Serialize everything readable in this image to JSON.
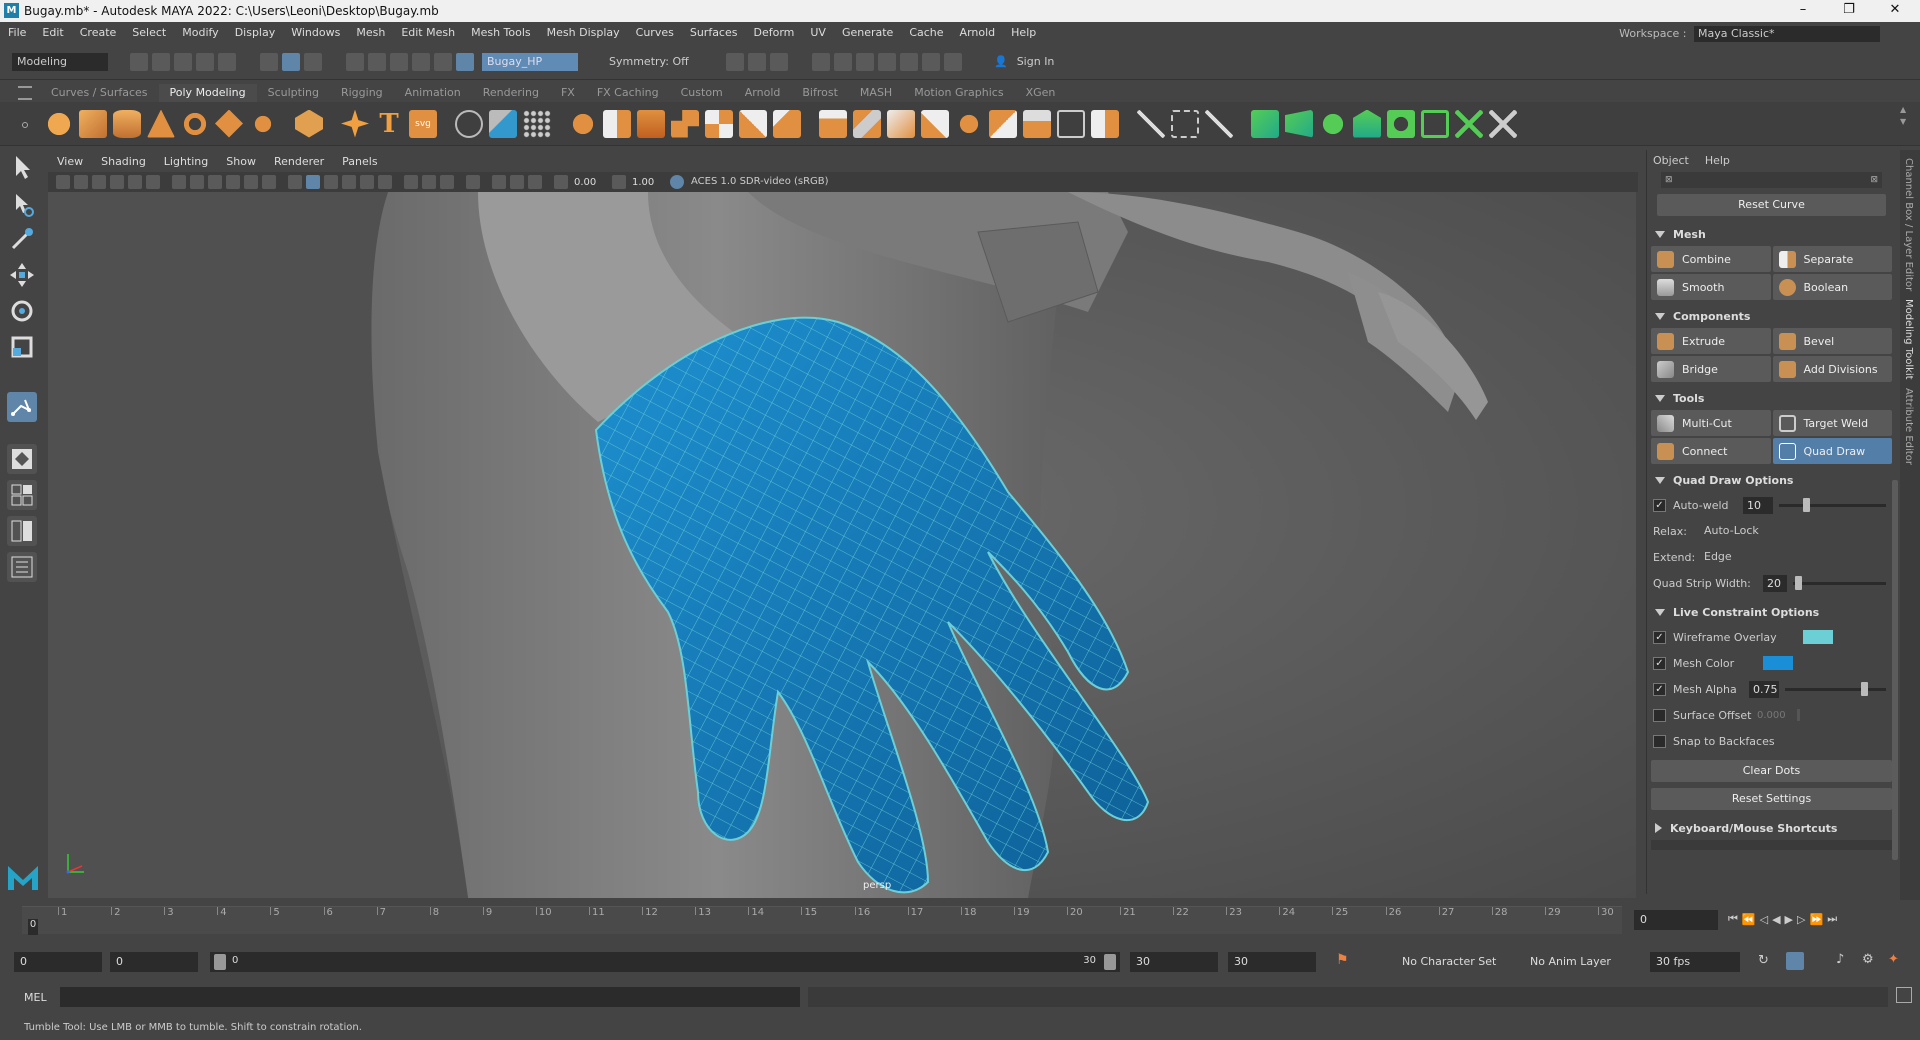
{
  "window": {
    "title": "Bugay.mb* - Autodesk MAYA 2022: C:\\Users\\Leoni\\Desktop\\Bugay.mb",
    "min": "–",
    "max": "❐",
    "close": "✕"
  },
  "menu": [
    "File",
    "Edit",
    "Create",
    "Select",
    "Modify",
    "Display",
    "Windows",
    "Mesh",
    "Edit Mesh",
    "Mesh Tools",
    "Mesh Display",
    "Curves",
    "Surfaces",
    "Deform",
    "UV",
    "Generate",
    "Cache",
    "Arnold",
    "Help"
  ],
  "workspace": {
    "label": "Workspace :",
    "value": "Maya Classic*"
  },
  "status": {
    "mode": "Modeling",
    "object": "Bugay_HP",
    "symmetry": "Symmetry: Off",
    "signin": "Sign In"
  },
  "shelf_tabs": [
    "Curves / Surfaces",
    "Poly Modeling",
    "Sculpting",
    "Rigging",
    "Animation",
    "Rendering",
    "FX",
    "FX Caching",
    "Custom",
    "Arnold",
    "Bifrost",
    "MASH",
    "Motion Graphics",
    "XGen"
  ],
  "shelf_active": "Poly Modeling",
  "viewport": {
    "menu": [
      "View",
      "Shading",
      "Lighting",
      "Show",
      "Renderer",
      "Panels"
    ],
    "exposure": "0.00",
    "gamma": "1.00",
    "colorspace": "ACES 1.0 SDR-video (sRGB)",
    "camera": "persp"
  },
  "panel": {
    "menu": [
      "Object",
      "Help"
    ],
    "reset_curve": "Reset Curve",
    "mesh_section": "Mesh",
    "combine": "Combine",
    "separate": "Separate",
    "smooth": "Smooth",
    "boolean": "Boolean",
    "components_section": "Components",
    "extrude": "Extrude",
    "bevel": "Bevel",
    "bridge": "Bridge",
    "add_divisions": "Add Divisions",
    "tools_section": "Tools",
    "multi_cut": "Multi-Cut",
    "target_weld": "Target Weld",
    "connect": "Connect",
    "quad_draw": "Quad Draw",
    "qd_options": "Quad Draw Options",
    "auto_weld": "Auto-weld",
    "auto_weld_value": "10",
    "relax_label": "Relax:",
    "relax_value": "Auto-Lock",
    "extend_label": "Extend:",
    "extend_value": "Edge",
    "strip_label": "Quad Strip Width:",
    "strip_value": "20",
    "live_section": "Live Constraint Options",
    "wireframe_overlay": "Wireframe Overlay",
    "mesh_color": "Mesh Color",
    "mesh_alpha": "Mesh Alpha",
    "mesh_alpha_value": "0.75",
    "surface_offset": "Surface Offset",
    "surface_offset_value": "0.000",
    "snap_backfaces": "Snap to Backfaces",
    "clear_dots": "Clear Dots",
    "reset_settings": "Reset Settings",
    "shortcuts": "Keyboard/Mouse Shortcuts",
    "wire_color": "#6ccfd6",
    "mesh_color_hex": "#1a8fd8"
  },
  "side_tabs": [
    "Channel Box / Layer Editor",
    "Modeling Toolkit",
    "Attribute Editor"
  ],
  "timeline": {
    "ticks": [
      "1",
      "2",
      "3",
      "4",
      "5",
      "6",
      "7",
      "8",
      "9",
      "10",
      "11",
      "12",
      "13",
      "14",
      "15",
      "16",
      "17",
      "18",
      "19",
      "20",
      "21",
      "22",
      "23",
      "24",
      "25",
      "26",
      "27",
      "28",
      "29",
      "30"
    ],
    "start_marker": "0",
    "current": "0"
  },
  "range": {
    "start": "0",
    "playback_start": "0",
    "slider_start": "0",
    "slider_end": "30",
    "playback_end": "30",
    "end": "30",
    "char_set": "No Character Set",
    "anim_layer": "No Anim Layer",
    "fps": "30 fps"
  },
  "cmdline": {
    "label": "MEL"
  },
  "help": "Tumble Tool: Use LMB or MMB to tumble. Shift to constrain rotation."
}
